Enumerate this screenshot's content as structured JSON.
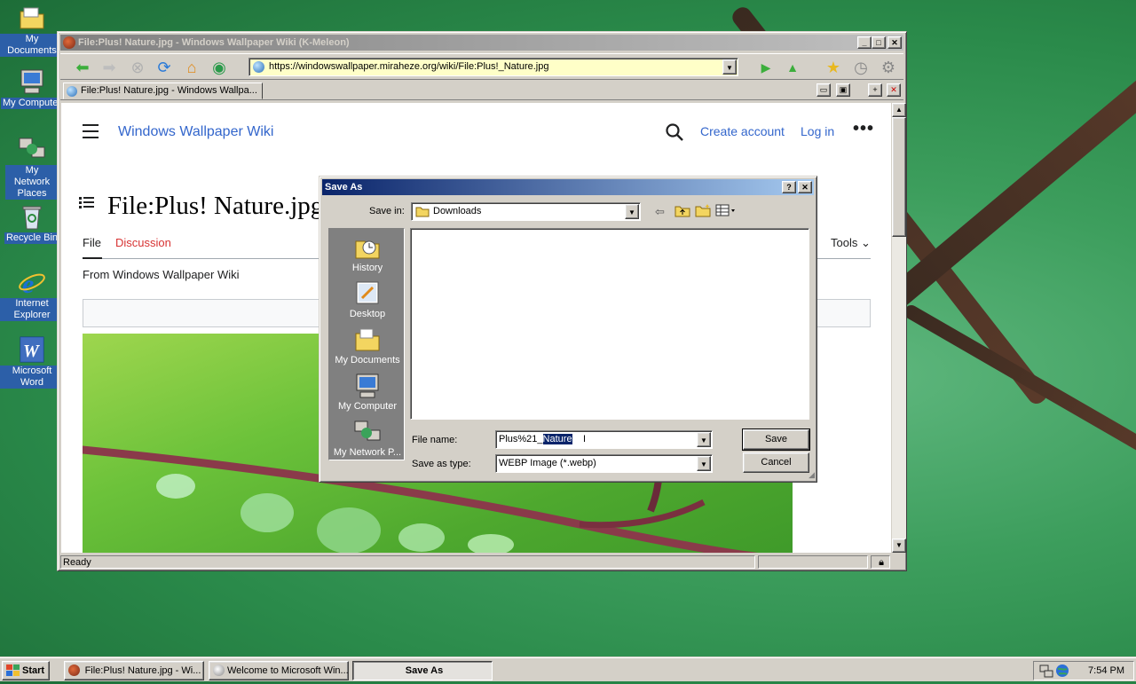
{
  "desktop": {
    "icons": [
      {
        "label": "My Documents"
      },
      {
        "label": "My Computer"
      },
      {
        "label": "My Network Places"
      },
      {
        "label": "Recycle Bin"
      },
      {
        "label": "Internet Explorer"
      },
      {
        "label": "Microsoft Word"
      }
    ]
  },
  "browser": {
    "title": "File:Plus! Nature.jpg - Windows Wallpaper Wiki (K-Meleon)",
    "url": "https://windowswallpaper.miraheze.org/wiki/File:Plus!_Nature.jpg",
    "tab_title": "File:Plus! Nature.jpg - Windows Wallpa...",
    "status": "Ready"
  },
  "wiki": {
    "site_name": "Windows Wallpaper Wiki",
    "create_account": "Create account",
    "log_in": "Log in",
    "more": "•••",
    "page_title": "File:Plus! Nature.jpg",
    "tab_file": "File",
    "tab_discussion": "Discussion",
    "tools": "Tools",
    "from": "From Windows Wallpaper Wiki"
  },
  "dialog": {
    "title": "Save As",
    "help": "?",
    "save_in_label": "Save in:",
    "save_in_value": "Downloads",
    "places": [
      {
        "label": "History",
        "icon": "history-icon"
      },
      {
        "label": "Desktop",
        "icon": "desktop-icon"
      },
      {
        "label": "My Documents",
        "icon": "my-documents-icon"
      },
      {
        "label": "My Computer",
        "icon": "my-computer-icon"
      },
      {
        "label": "My Network P...",
        "icon": "network-icon"
      }
    ],
    "file_name_label": "File name:",
    "file_name_plain": "Plus%21_",
    "file_name_selected": "Nature",
    "save_as_type_label": "Save as type:",
    "save_as_type_value": "WEBP Image (*.webp)",
    "save_button": "Save",
    "cancel_button": "Cancel"
  },
  "taskbar": {
    "start": "Start",
    "tasks": [
      {
        "label": "File:Plus! Nature.jpg - Wi..."
      },
      {
        "label": "Welcome to Microsoft Win..."
      },
      {
        "label": "Save As"
      }
    ],
    "clock": "7:54 PM"
  },
  "colors": {
    "wiki_link": "#3366cc",
    "wiki_discussion": "#d73333",
    "active_title": "#0a246a",
    "url_background": "#ffffc8"
  }
}
